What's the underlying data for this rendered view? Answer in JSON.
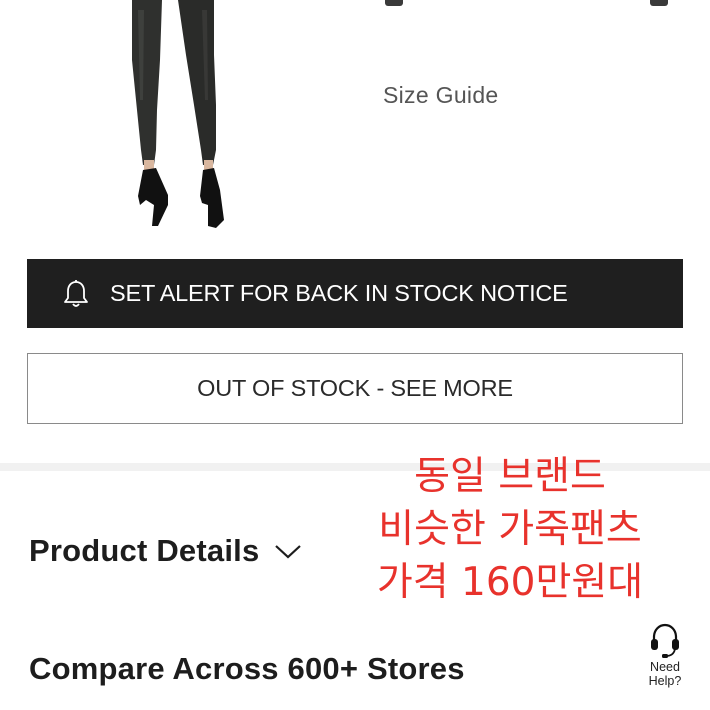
{
  "product": {
    "image_icon": "model-wearing-pants-image"
  },
  "size_guide": {
    "label": "Size Guide"
  },
  "alert_button": {
    "icon": "bell-icon",
    "label": "SET ALERT FOR BACK IN STOCK NOTICE"
  },
  "out_of_stock_button": {
    "label": "OUT OF STOCK - SEE MORE"
  },
  "overlay_note": {
    "color": "#e8322c",
    "lines": [
      "동일 브랜드",
      "비슷한 가죽팬츠",
      "가격 160만원대"
    ]
  },
  "product_details": {
    "title": "Product Details",
    "icon": "chevron-down-icon"
  },
  "compare": {
    "title": "Compare Across 600+ Stores"
  },
  "help": {
    "icon": "headset-icon",
    "line1": "Need",
    "line2": "Help?"
  },
  "colors": {
    "button_dark": "#1f1f1f",
    "accent_red": "#e8322c"
  }
}
